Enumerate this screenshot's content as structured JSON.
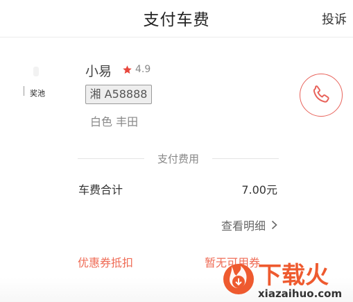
{
  "header": {
    "title": "支付车费",
    "complain_label": "投诉"
  },
  "driver": {
    "badge": "奖池",
    "name": "小易",
    "rating": "4.9",
    "plate": "湘 A58888",
    "car": "白色  丰田"
  },
  "payment": {
    "section_title": "支付费用",
    "total_label": "车费合计",
    "total_amount": "7.00元",
    "details_label": "查看明细",
    "coupon_label": "优惠券抵扣",
    "coupon_value": "暂无可用券"
  },
  "watermark": {
    "brand": "下载火",
    "domain": "xiazaihuo.com"
  },
  "colors": {
    "accent": "#ef6b55",
    "call_ring": "#e8625a",
    "star": "#e8473d"
  },
  "icons": [
    "star-icon",
    "phone-icon",
    "chevron-right-icon",
    "watermark-logo-icon"
  ]
}
